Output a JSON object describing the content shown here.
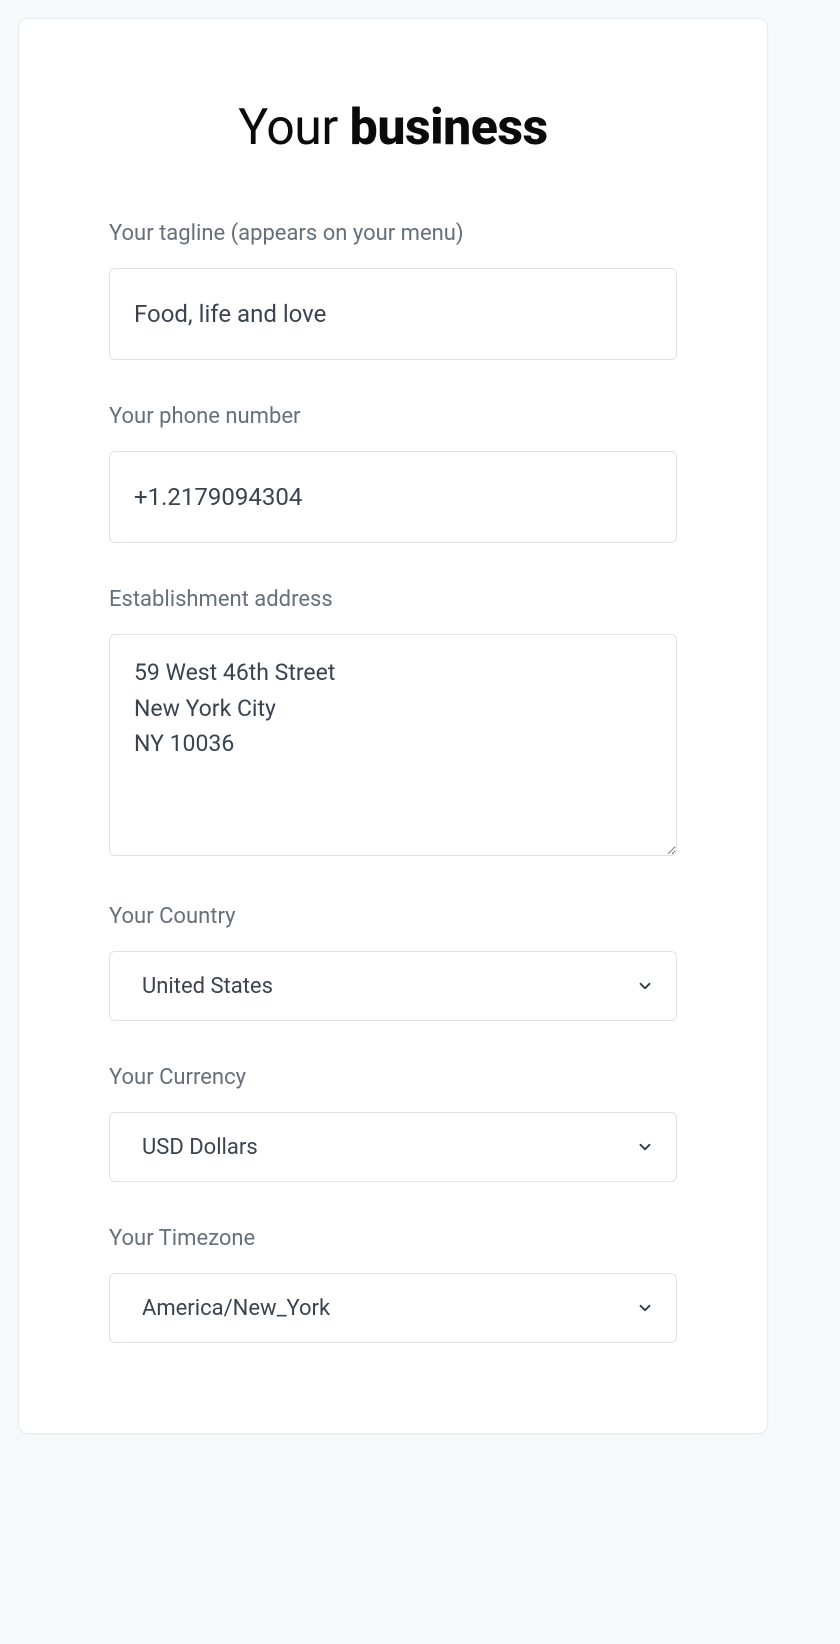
{
  "title": {
    "part1": "Your ",
    "part2": "business"
  },
  "fields": {
    "tagline": {
      "label": "Your tagline (appears on your menu)",
      "value": "Food, life and love"
    },
    "phone": {
      "label": "Your phone number",
      "value": "+1.2179094304"
    },
    "address": {
      "label": "Establishment address",
      "value": "59 West 46th Street\nNew York City\nNY 10036"
    },
    "country": {
      "label": "Your Country",
      "value": "United States"
    },
    "currency": {
      "label": "Your Currency",
      "value": "USD Dollars"
    },
    "timezone": {
      "label": "Your Timezone",
      "value": "America/New_York"
    }
  }
}
